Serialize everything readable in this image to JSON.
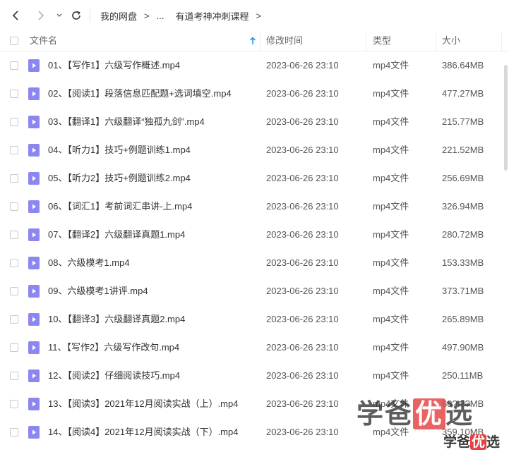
{
  "breadcrumb": {
    "root": "我的网盘",
    "gt1": ">",
    "ellipsis": "...",
    "current": "有道考神冲刺课程",
    "gt2": ">"
  },
  "columns": {
    "name": "文件名",
    "modified": "修改时间",
    "type": "类型",
    "size": "大小"
  },
  "files": [
    {
      "name": "01、【写作1】六级写作概述.mp4",
      "modified": "2023-06-26 23:10",
      "type": "mp4文件",
      "size": "386.64MB"
    },
    {
      "name": "02、【阅读1】段落信息匹配题+选词填空.mp4",
      "modified": "2023-06-26 23:10",
      "type": "mp4文件",
      "size": "477.27MB"
    },
    {
      "name": "03、【翻译1】六级翻译“独孤九剑”.mp4",
      "modified": "2023-06-26 23:10",
      "type": "mp4文件",
      "size": "215.77MB"
    },
    {
      "name": "04、【听力1】技巧+例题训练1.mp4",
      "modified": "2023-06-26 23:10",
      "type": "mp4文件",
      "size": "221.52MB"
    },
    {
      "name": "05、【听力2】技巧+例题训练2.mp4",
      "modified": "2023-06-26 23:10",
      "type": "mp4文件",
      "size": "256.69MB"
    },
    {
      "name": "06、【词汇1】考前词汇串讲-上.mp4",
      "modified": "2023-06-26 23:10",
      "type": "mp4文件",
      "size": "326.94MB"
    },
    {
      "name": "07、【翻译2】六级翻译真题1.mp4",
      "modified": "2023-06-26 23:10",
      "type": "mp4文件",
      "size": "280.72MB"
    },
    {
      "name": "08、六级模考1.mp4",
      "modified": "2023-06-26 23:10",
      "type": "mp4文件",
      "size": "153.33MB"
    },
    {
      "name": "09、六级模考1讲评.mp4",
      "modified": "2023-06-26 23:10",
      "type": "mp4文件",
      "size": "373.71MB"
    },
    {
      "name": "10、【翻译3】六级翻译真题2.mp4",
      "modified": "2023-06-26 23:10",
      "type": "mp4文件",
      "size": "265.89MB"
    },
    {
      "name": "11、【写作2】六级写作改句.mp4",
      "modified": "2023-06-26 23:10",
      "type": "mp4文件",
      "size": "497.90MB"
    },
    {
      "name": "12、【阅读2】仔细阅读技巧.mp4",
      "modified": "2023-06-26 23:10",
      "type": "mp4文件",
      "size": "250.11MB"
    },
    {
      "name": "13、【阅读3】2021年12月阅读实战（上）.mp4",
      "modified": "2023-06-26 23:10",
      "type": "mp4文件",
      "size": "60?.??MB"
    },
    {
      "name": "14、【阅读4】2021年12月阅读实战（下）.mp4",
      "modified": "2023-06-26 23:10",
      "type": "mp4文件",
      "size": "359.10MB"
    }
  ],
  "watermark": {
    "part1": "学爸",
    "part2": "优",
    "part3": "选"
  },
  "colors": {
    "file_icon": "#8c86f0",
    "sort_arrow": "#1a8ce8",
    "watermark_red": "#e6403f"
  }
}
